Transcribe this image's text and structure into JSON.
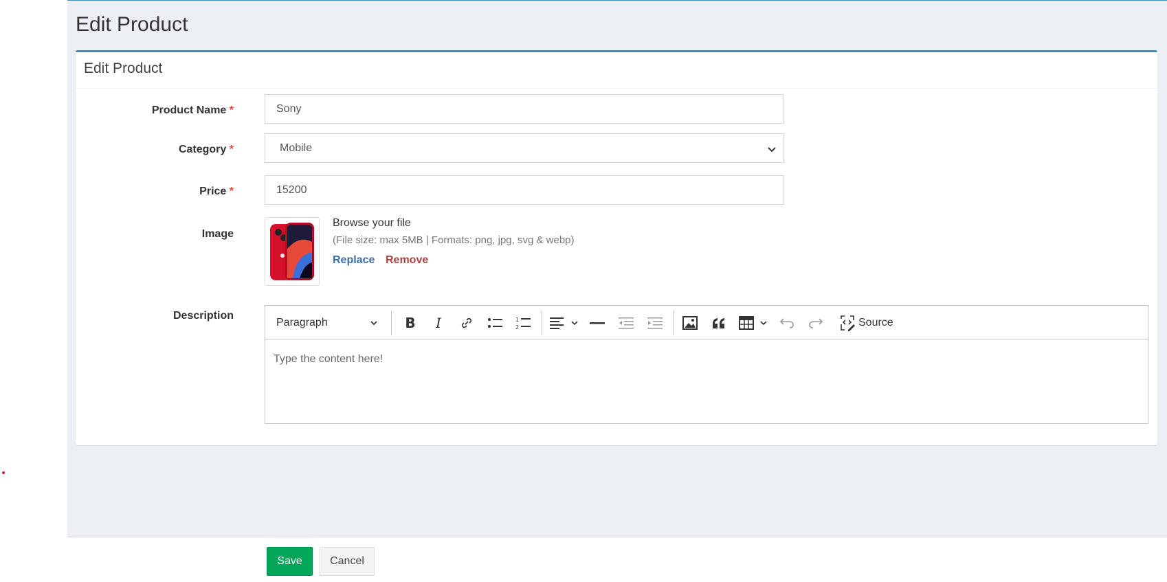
{
  "page": {
    "title": "Edit Product"
  },
  "box": {
    "title": "Edit Product"
  },
  "form": {
    "product_name": {
      "label": "Product Name",
      "required": "*",
      "value": "Sony"
    },
    "category": {
      "label": "Category",
      "required": "*",
      "value": "Mobile"
    },
    "price": {
      "label": "Price",
      "required": "*",
      "value": "15200"
    },
    "image": {
      "label": "Image",
      "browse_title": "Browse your file",
      "note": "(File size: max 5MB | Formats: png, jpg, svg & webp)",
      "replace": "Replace",
      "remove": "Remove"
    },
    "description": {
      "label": "Description",
      "heading_select": "Paragraph",
      "source_label": "Source",
      "placeholder": "Type the content here!"
    }
  },
  "toolbar_icons": [
    "bold-icon",
    "italic-icon",
    "link-icon",
    "bulleted-list-icon",
    "numbered-list-icon",
    "align-icon",
    "horizontal-line-icon",
    "outdent-icon",
    "indent-icon",
    "insert-image-icon",
    "blockquote-icon",
    "table-icon",
    "undo-icon",
    "redo-icon",
    "source-icon"
  ],
  "footer": {
    "save": "Save",
    "cancel": "Cancel"
  },
  "colors": {
    "accent": "#3c8dbc",
    "save": "#00a65a",
    "required": "#dd4b39",
    "replace": "#3c6ea8",
    "remove": "#a94442"
  }
}
